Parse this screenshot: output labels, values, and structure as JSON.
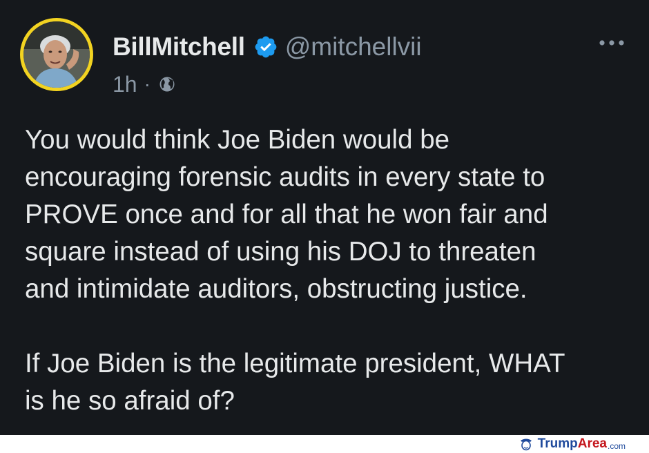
{
  "tweet": {
    "author": {
      "display_name": "BillMitchell",
      "handle": "@mitchellvii",
      "verified": true,
      "avatar_icon": "user-avatar"
    },
    "meta": {
      "time": "1h",
      "separator": "·",
      "audience_icon": "globe-icon"
    },
    "menu_icon": "more-options-icon",
    "body": [
      "You would think Joe Biden would be\nencouraging forensic audits in every state to\nPROVE once and for all that he won fair and\nsquare instead of using his DOJ to threaten\nand intimidate auditors, obstructing justice.",
      "If Joe Biden is the legitimate president, WHAT\nis he so afraid of?"
    ]
  },
  "watermark": {
    "part1": "Trump",
    "part2": "Area",
    "part3": ".com"
  },
  "colors": {
    "background": "#15181c",
    "text": "#e7e9ea",
    "secondary_text": "#8b98a5",
    "verified_blue": "#1d9bf0",
    "avatar_ring": "#f2d321"
  }
}
